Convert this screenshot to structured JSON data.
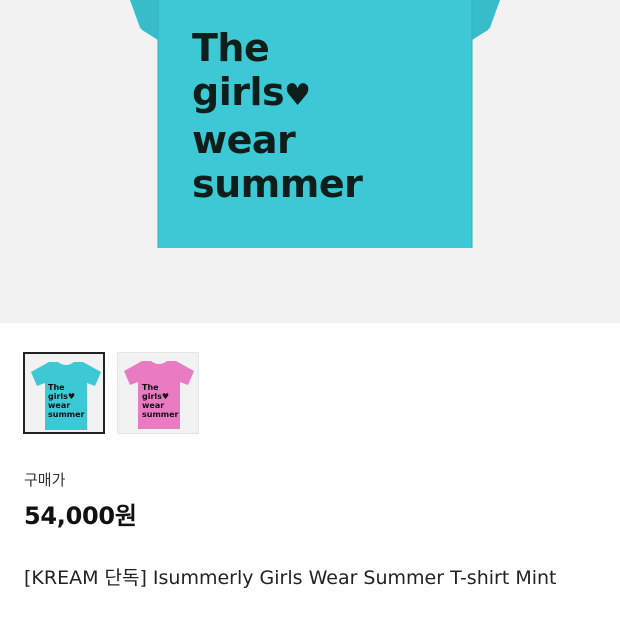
{
  "product_image": {
    "shirt_color": "#3cc8d4",
    "background_color": "#f2f2f2",
    "print_lines": [
      "The",
      "girls",
      "wear",
      "summer"
    ],
    "print_icon": "heart-icon"
  },
  "thumbnails": [
    {
      "label": "mint",
      "color": "#3cc8d4",
      "selected": true,
      "print_lines": [
        "The",
        "girls",
        "wear",
        "summer"
      ]
    },
    {
      "label": "pink",
      "color": "#e97bc3",
      "selected": false,
      "print_lines": [
        "The",
        "girls",
        "wear",
        "summer"
      ]
    }
  ],
  "price": {
    "label": "구매가",
    "value": "54,000원"
  },
  "product_title": "[KREAM 단독] Isummerly Girls Wear Summer T-shirt Mint"
}
